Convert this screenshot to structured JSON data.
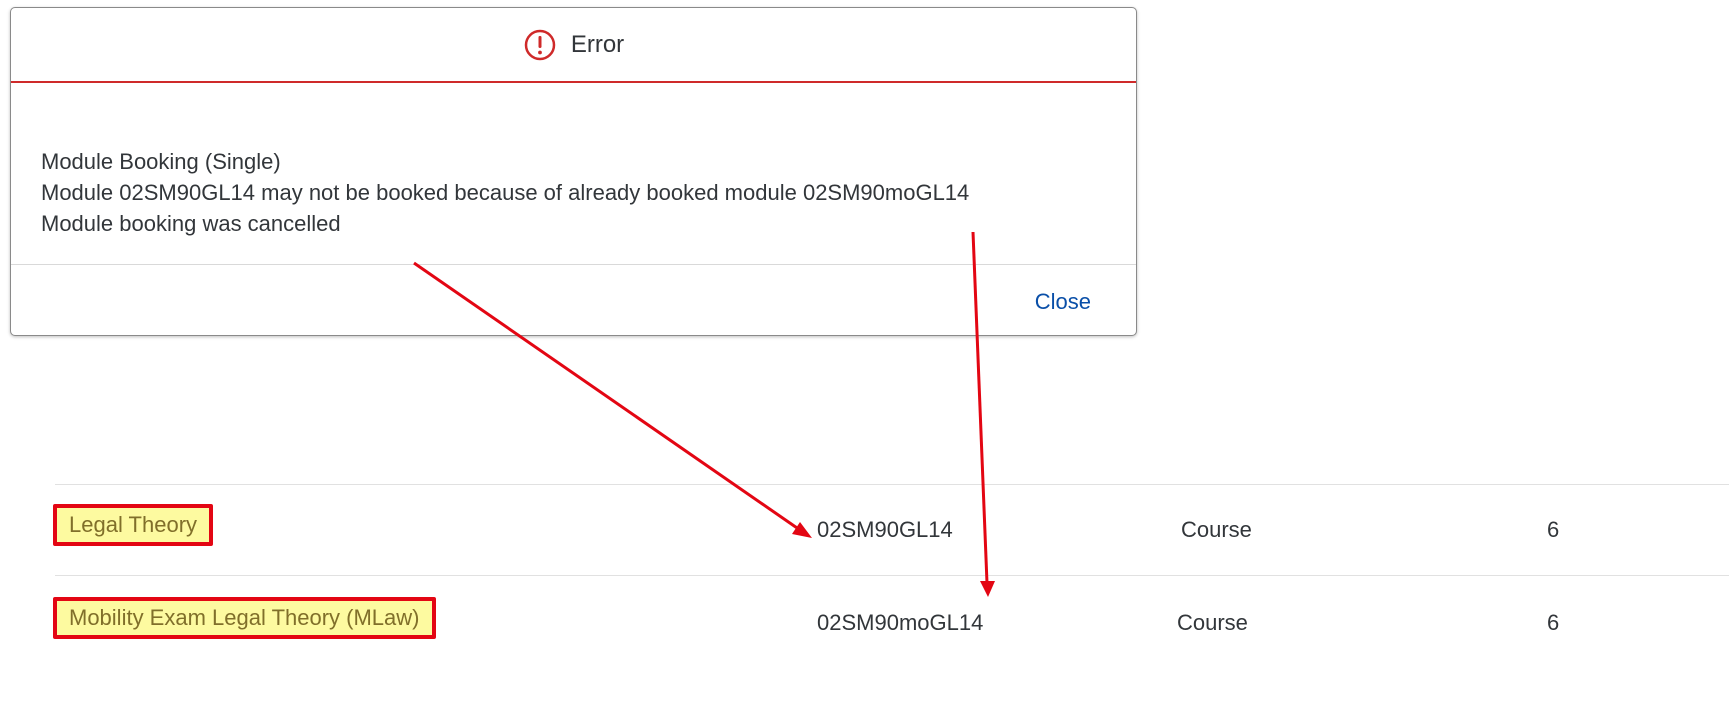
{
  "dialog": {
    "title": "Error",
    "icon": "error-circle-icon",
    "accent_color": "#cf2a2a",
    "messages": [
      "Module Booking (Single)",
      "Module 02SM90GL14 may not be booked because of already booked module 02SM90moGL14",
      "Module booking was cancelled"
    ],
    "close_label": "Close"
  },
  "table": {
    "rows": [
      {
        "name": "Legal Theory",
        "code": "02SM90GL14",
        "type": "Course",
        "credits": "6"
      },
      {
        "name": "Mobility Exam Legal Theory (MLaw)",
        "code": "02SM90moGL14",
        "type": "Course",
        "credits": "6"
      }
    ]
  },
  "annotation": {
    "color": "#e30613",
    "highlight": "#fdfaa0"
  }
}
